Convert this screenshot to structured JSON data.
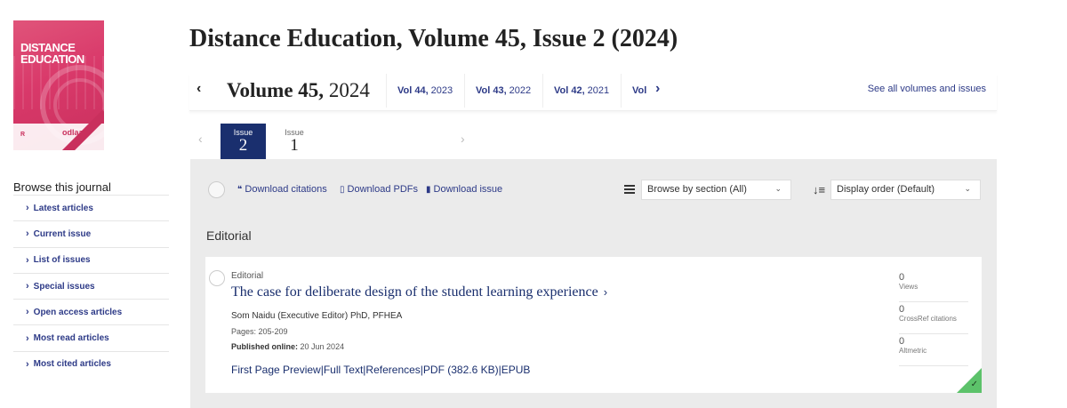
{
  "cover": {
    "title_line1": "DISTANCE",
    "title_line2": "EDUCATION",
    "brand_left": "Routledge",
    "brand_right": "odlaa"
  },
  "sidebar": {
    "title": "Browse this journal",
    "items": [
      {
        "label": "Latest articles"
      },
      {
        "label": "Current issue"
      },
      {
        "label": "List of issues"
      },
      {
        "label": "Special issues"
      },
      {
        "label": "Open access articles"
      },
      {
        "label": "Most read articles"
      },
      {
        "label": "Most cited articles"
      }
    ]
  },
  "header": {
    "title": "Distance Education, Volume 45, Issue 2 (2024)"
  },
  "volumes": {
    "current_label": "Volume 45,",
    "current_year": "2024",
    "others": [
      {
        "label": "Vol 44,",
        "year": "2023"
      },
      {
        "label": "Vol 43,",
        "year": "2022"
      },
      {
        "label": "Vol 42,",
        "year": "2021"
      },
      {
        "label": "Vol",
        "year": ""
      }
    ],
    "see_all": "See all volumes and issues"
  },
  "issues": {
    "active": {
      "label": "Issue",
      "number": "2"
    },
    "other": {
      "label": "Issue",
      "number": "1"
    }
  },
  "toolbar": {
    "download_citations": "Download citations",
    "download_pdfs": "Download PDFs",
    "download_issue": "Download issue",
    "browse_select": "Browse by section (All)",
    "order_select": "Display order (Default)"
  },
  "section": {
    "heading": "Editorial"
  },
  "article": {
    "type": "Editorial",
    "title": "The case for deliberate design of the student learning experience",
    "authors": "Som Naidu (Executive Editor) PhD, PFHEA",
    "pages": "Pages: 205-209",
    "published_label": "Published online:",
    "published_date": "20 Jun 2024",
    "links": {
      "first_page": "First Page Preview",
      "full_text": "Full Text",
      "references": "References",
      "pdf": "PDF (382.6 KB)",
      "epub": "EPUB"
    },
    "metrics": [
      {
        "value": "0",
        "label": "Views"
      },
      {
        "value": "0",
        "label": "CrossRef citations"
      },
      {
        "value": "0",
        "label": "Altmetric"
      }
    ],
    "access_color": "#5cc26a"
  }
}
